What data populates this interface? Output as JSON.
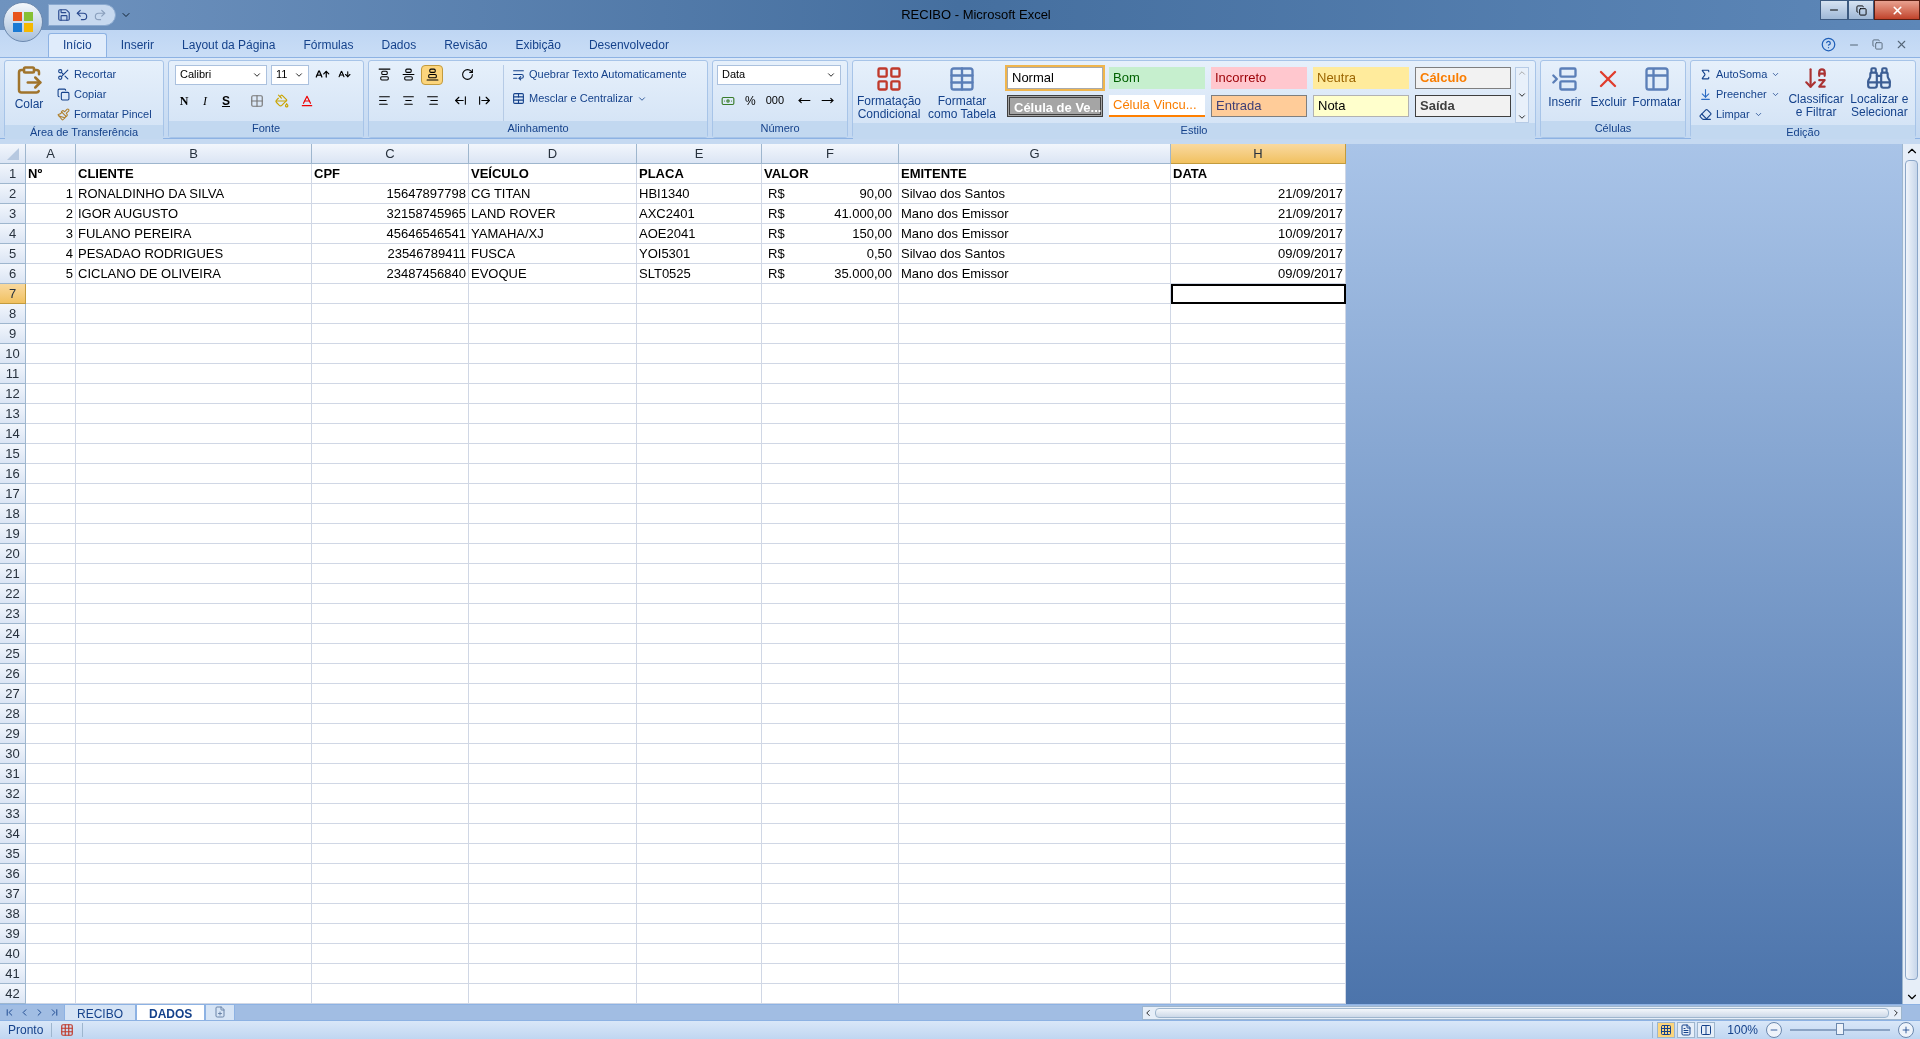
{
  "window": {
    "title": "RECIBO - Microsoft Excel"
  },
  "ribbon_tabs": [
    {
      "label": "Início",
      "selected": true
    },
    {
      "label": "Inserir",
      "selected": false
    },
    {
      "label": "Layout da Página",
      "selected": false
    },
    {
      "label": "Fórmulas",
      "selected": false
    },
    {
      "label": "Dados",
      "selected": false
    },
    {
      "label": "Revisão",
      "selected": false
    },
    {
      "label": "Exibição",
      "selected": false
    },
    {
      "label": "Desenvolvedor",
      "selected": false
    }
  ],
  "clipboard": {
    "paste": "Colar",
    "cut": "Recortar",
    "copy": "Copiar",
    "format_painter": "Formatar Pincel",
    "group": "Área de Transferência"
  },
  "font": {
    "name": "Calibri",
    "size": "11",
    "bold": "N",
    "italic": "I",
    "underline": "S",
    "group": "Fonte"
  },
  "alignment": {
    "vertical_align": [
      {
        "selected": false
      },
      {
        "selected": false
      },
      {
        "selected": true
      }
    ],
    "wrap_text": "Quebrar Texto Automaticamente",
    "merge": "Mesclar e Centralizar",
    "group": "Alinhamento"
  },
  "number": {
    "format": "Data",
    "percent": "%",
    "thousands": "000",
    "group": "Número"
  },
  "styles": {
    "conditional": "Formatação Condicional",
    "as_table": "Formatar como Tabela",
    "group": "Estilo",
    "cells": [
      {
        "label": "Normal",
        "kind": "normal",
        "selected": true
      },
      {
        "label": "Bom",
        "kind": "good",
        "selected": false
      },
      {
        "label": "Incorreto",
        "kind": "bad",
        "selected": false
      },
      {
        "label": "Neutra",
        "kind": "neutral",
        "selected": false
      },
      {
        "label": "Cálculo",
        "kind": "calculation",
        "selected": false
      },
      {
        "label": "Célula de Ve...",
        "kind": "check",
        "selected": false
      },
      {
        "label": "Célula Vincu...",
        "kind": "linked",
        "selected": false
      },
      {
        "label": "Entrada",
        "kind": "input",
        "selected": false
      },
      {
        "label": "Nota",
        "kind": "note",
        "selected": false
      },
      {
        "label": "Saída",
        "kind": "output",
        "selected": false
      }
    ]
  },
  "cells_group": {
    "insert": "Inserir",
    "delete": "Excluir",
    "format": "Formatar",
    "group": "Células"
  },
  "editing": {
    "autosum": "AutoSoma",
    "fill": "Preencher",
    "clear": "Limpar",
    "sort": "Classificar e Filtrar",
    "find": "Localizar e Selecionar",
    "group": "Edição"
  },
  "sheet": {
    "columns": [
      {
        "letter": "A",
        "selected": false
      },
      {
        "letter": "B",
        "selected": false
      },
      {
        "letter": "C",
        "selected": false
      },
      {
        "letter": "D",
        "selected": false
      },
      {
        "letter": "E",
        "selected": false
      },
      {
        "letter": "F",
        "selected": false
      },
      {
        "letter": "G",
        "selected": false
      },
      {
        "letter": "H",
        "selected": true
      }
    ],
    "rows": [
      {
        "number": "1",
        "selected": false,
        "cells": [
          "Nº",
          "CLIENTE",
          "CPF",
          "VEÍCULO",
          "PLACA",
          "VALOR",
          "EMITENTE",
          "DATA"
        ]
      },
      {
        "number": "2",
        "selected": false,
        "cells": [
          "1",
          "RONALDINHO DA SILVA",
          "15647897798",
          "CG TITAN",
          "HBI1340",
          {
            "symbol": "R$",
            "amount": "90,00"
          },
          "Silvao dos Santos",
          "21/09/2017"
        ]
      },
      {
        "number": "3",
        "selected": false,
        "cells": [
          "2",
          "IGOR AUGUSTO",
          "32158745965",
          "LAND ROVER",
          "AXC2401",
          {
            "symbol": "R$",
            "amount": "41.000,00"
          },
          "Mano dos Emissor",
          "21/09/2017"
        ]
      },
      {
        "number": "4",
        "selected": false,
        "cells": [
          "3",
          "FULANO PEREIRA",
          "45646546541",
          "YAMAHA/XJ",
          "AOE2041",
          {
            "symbol": "R$",
            "amount": "150,00"
          },
          "Mano dos Emissor",
          "10/09/2017"
        ]
      },
      {
        "number": "5",
        "selected": false,
        "cells": [
          "4",
          "PESADAO RODRIGUES",
          "23546789411",
          "FUSCA",
          "YOI5301",
          {
            "symbol": "R$",
            "amount": "0,50"
          },
          "Silvao dos Santos",
          "09/09/2017"
        ]
      },
      {
        "number": "6",
        "selected": false,
        "cells": [
          "5",
          "CICLANO DE OLIVEIRA",
          "23487456840",
          "EVOQUE",
          "SLT0525",
          {
            "symbol": "R$",
            "amount": "35.000,00"
          },
          "Mano dos Emissor",
          "09/09/2017"
        ]
      },
      {
        "number": "7",
        "selected": true
      },
      {
        "number": "8",
        "selected": false
      },
      {
        "number": "9",
        "selected": false
      },
      {
        "number": "10",
        "selected": false
      },
      {
        "number": "11",
        "selected": false
      },
      {
        "number": "12",
        "selected": false
      },
      {
        "number": "13",
        "selected": false
      },
      {
        "number": "14",
        "selected": false
      },
      {
        "number": "15",
        "selected": false
      },
      {
        "number": "16",
        "selected": false
      },
      {
        "number": "17",
        "selected": false
      },
      {
        "number": "18",
        "selected": false
      },
      {
        "number": "19",
        "selected": false
      },
      {
        "number": "20",
        "selected": false
      },
      {
        "number": "21",
        "selected": false
      },
      {
        "number": "22",
        "selected": false
      },
      {
        "number": "23",
        "selected": false
      },
      {
        "number": "24",
        "selected": false
      },
      {
        "number": "25",
        "selected": false
      },
      {
        "number": "26",
        "selected": false
      },
      {
        "number": "27",
        "selected": false
      },
      {
        "number": "28",
        "selected": false
      },
      {
        "number": "29",
        "selected": false
      },
      {
        "number": "30",
        "selected": false
      },
      {
        "number": "31",
        "selected": false
      },
      {
        "number": "32",
        "selected": false
      },
      {
        "number": "33",
        "selected": false
      },
      {
        "number": "34",
        "selected": false
      },
      {
        "number": "35",
        "selected": false
      },
      {
        "number": "36",
        "selected": false
      },
      {
        "number": "37",
        "selected": false
      },
      {
        "number": "38",
        "selected": false
      },
      {
        "number": "39",
        "selected": false
      },
      {
        "number": "40",
        "selected": false
      },
      {
        "number": "41",
        "selected": false
      },
      {
        "number": "42",
        "selected": false
      }
    ]
  },
  "sheet_tabs": [
    {
      "label": "RECIBO",
      "selected": false
    },
    {
      "label": "DADOS",
      "selected": true
    }
  ],
  "status_bar": {
    "state": "Pronto",
    "views": [
      {
        "selected": true
      },
      {
        "selected": false
      },
      {
        "selected": false
      }
    ],
    "zoom": "100%",
    "zoom_slider": {
      "level": 0.5
    }
  }
}
